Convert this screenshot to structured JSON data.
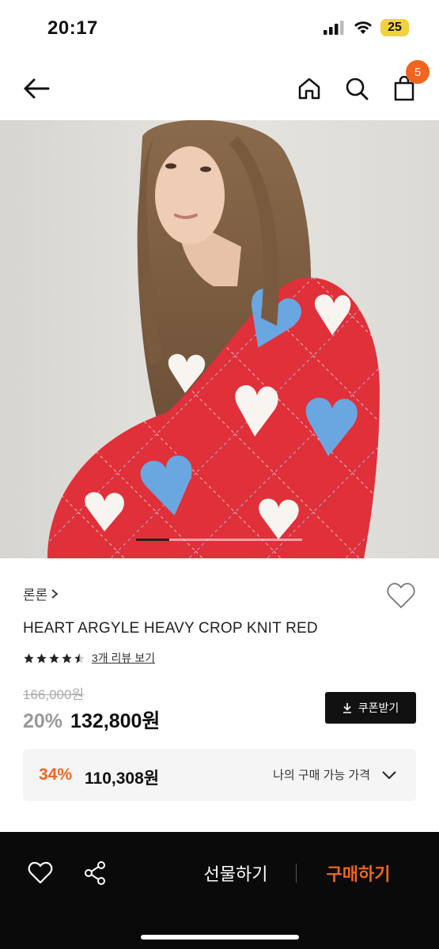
{
  "status_bar": {
    "time": "20:17",
    "battery": "25"
  },
  "nav": {
    "cart_count": "5"
  },
  "product": {
    "brand": "론론",
    "name": "HEART ARGYLE HEAVY CROP KNIT RED",
    "rating": 4.5,
    "review_link": "3개 리뷰 보기",
    "original_price": "166,000원",
    "discount": "20%",
    "sale_price": "132,800원",
    "coupon_label": "쿠폰받기"
  },
  "my_price": {
    "discount": "34%",
    "price": "110,308원",
    "label": "나의 구매 가능 가격"
  },
  "bottom_bar": {
    "gift_label": "선물하기",
    "buy_label": "구매하기"
  },
  "carousel": {
    "active_fraction": 0.2
  },
  "colors": {
    "accent": "#f0651f",
    "sweater_red": "#e0303a",
    "heart_blue": "#6aa6e0"
  }
}
